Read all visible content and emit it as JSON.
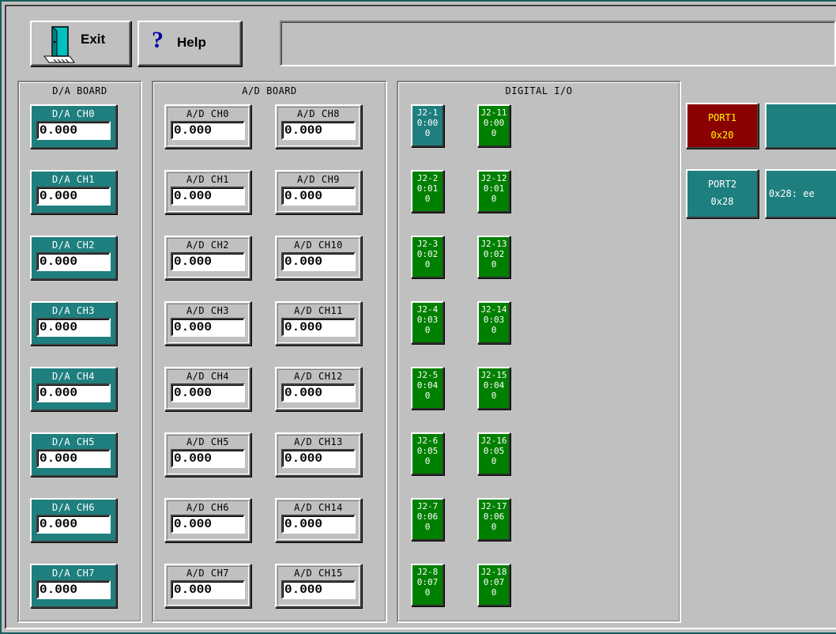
{
  "toolbar": {
    "exit_label": "Exit",
    "help_label": "Help",
    "status_text": ""
  },
  "da_board": {
    "title": "D/A BOARD",
    "channels": [
      {
        "label": "D/A CH0",
        "value": "0.000"
      },
      {
        "label": "D/A CH1",
        "value": "0.000"
      },
      {
        "label": "D/A CH2",
        "value": "0.000"
      },
      {
        "label": "D/A CH3",
        "value": "0.000"
      },
      {
        "label": "D/A CH4",
        "value": "0.000"
      },
      {
        "label": "D/A CH5",
        "value": "0.000"
      },
      {
        "label": "D/A CH6",
        "value": "0.000"
      },
      {
        "label": "D/A CH7",
        "value": "0.000"
      }
    ]
  },
  "ad_board": {
    "title": "A/D BOARD",
    "channels": [
      {
        "label": "A/D CH0",
        "value": "0.000"
      },
      {
        "label": "A/D CH1",
        "value": "0.000"
      },
      {
        "label": "A/D CH2",
        "value": "0.000"
      },
      {
        "label": "A/D CH3",
        "value": "0.000"
      },
      {
        "label": "A/D CH4",
        "value": "0.000"
      },
      {
        "label": "A/D CH5",
        "value": "0.000"
      },
      {
        "label": "A/D CH6",
        "value": "0.000"
      },
      {
        "label": "A/D CH7",
        "value": "0.000"
      },
      {
        "label": "A/D CH8",
        "value": "0.000"
      },
      {
        "label": "A/D CH9",
        "value": "0.000"
      },
      {
        "label": "A/D CH10",
        "value": "0.000"
      },
      {
        "label": "A/D CH11",
        "value": "0.000"
      },
      {
        "label": "A/D CH12",
        "value": "0.000"
      },
      {
        "label": "A/D CH13",
        "value": "0.000"
      },
      {
        "label": "A/D CH14",
        "value": "0.000"
      },
      {
        "label": "A/D CH15",
        "value": "0.000"
      }
    ]
  },
  "digital_io": {
    "title": "DIGITAL I/O",
    "bits": [
      {
        "pin": "J2-1",
        "addr": "0:00",
        "state": "0"
      },
      {
        "pin": "J2-2",
        "addr": "0:01",
        "state": "0"
      },
      {
        "pin": "J2-3",
        "addr": "0:02",
        "state": "0"
      },
      {
        "pin": "J2-4",
        "addr": "0:03",
        "state": "0"
      },
      {
        "pin": "J2-5",
        "addr": "0:04",
        "state": "0"
      },
      {
        "pin": "J2-6",
        "addr": "0:05",
        "state": "0"
      },
      {
        "pin": "J2-7",
        "addr": "0:06",
        "state": "0"
      },
      {
        "pin": "J2-8",
        "addr": "0:07",
        "state": "0"
      },
      {
        "pin": "J2-11",
        "addr": "0:00",
        "state": "0"
      },
      {
        "pin": "J2-12",
        "addr": "0:01",
        "state": "0"
      },
      {
        "pin": "J2-13",
        "addr": "0:02",
        "state": "0"
      },
      {
        "pin": "J2-14",
        "addr": "0:03",
        "state": "0"
      },
      {
        "pin": "J2-15",
        "addr": "0:04",
        "state": "0"
      },
      {
        "pin": "J2-16",
        "addr": "0:05",
        "state": "0"
      },
      {
        "pin": "J2-17",
        "addr": "0:06",
        "state": "0"
      },
      {
        "pin": "J2-18",
        "addr": "0:07",
        "state": "0"
      }
    ]
  },
  "ports": {
    "port1": {
      "name": "PORT1",
      "addr": "0x20"
    },
    "port1_value": "",
    "port2": {
      "name": "PORT2",
      "addr": "0x28"
    },
    "port2_value": "0x28: ee"
  },
  "colors": {
    "teal": "#1f7f7f",
    "green": "#008000",
    "port1_bg": "#8b0000",
    "port1_text": "#ffff00",
    "panel": "#c0c0c0"
  }
}
